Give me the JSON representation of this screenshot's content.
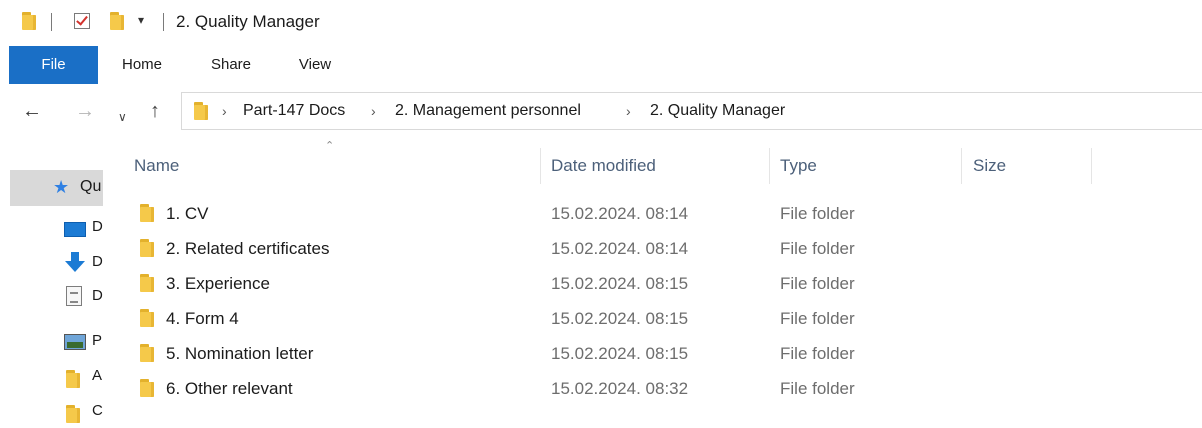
{
  "title_bar": {
    "title": "2. Quality Manager",
    "dropdown_glyph": "▾"
  },
  "ribbon": {
    "tabs": [
      {
        "label": "File",
        "active": true
      },
      {
        "label": "Home"
      },
      {
        "label": "Share"
      },
      {
        "label": "View"
      }
    ],
    "accent_color": "#1a6fc6"
  },
  "address_bar": {
    "breadcrumbs": [
      "Part-147 Docs",
      "2. Management personnel",
      "2. Quality Manager"
    ]
  },
  "nav_pane": {
    "items": [
      {
        "icon": "star-icon",
        "label": "Qu"
      },
      {
        "icon": "desktop-icon",
        "label": "D"
      },
      {
        "icon": "downloads-icon",
        "label": "D"
      },
      {
        "icon": "documents-icon",
        "label": "D"
      },
      {
        "icon": "pictures-icon",
        "label": "P"
      },
      {
        "icon": "folder-icon",
        "label": "A"
      },
      {
        "icon": "folder-icon",
        "label": "C"
      }
    ]
  },
  "file_list": {
    "columns": [
      "Name",
      "Date modified",
      "Type",
      "Size"
    ],
    "rows": [
      {
        "name": "1. CV",
        "date": "15.02.2024. 08:14",
        "type": "File folder",
        "size": ""
      },
      {
        "name": "2. Related certificates",
        "date": "15.02.2024. 08:14",
        "type": "File folder",
        "size": ""
      },
      {
        "name": "3. Experience",
        "date": "15.02.2024. 08:15",
        "type": "File folder",
        "size": ""
      },
      {
        "name": "4. Form 4",
        "date": "15.02.2024. 08:15",
        "type": "File folder",
        "size": ""
      },
      {
        "name": "5. Nomination letter",
        "date": "15.02.2024. 08:15",
        "type": "File folder",
        "size": ""
      },
      {
        "name": "6. Other relevant",
        "date": "15.02.2024. 08:32",
        "type": "File folder",
        "size": ""
      }
    ]
  }
}
